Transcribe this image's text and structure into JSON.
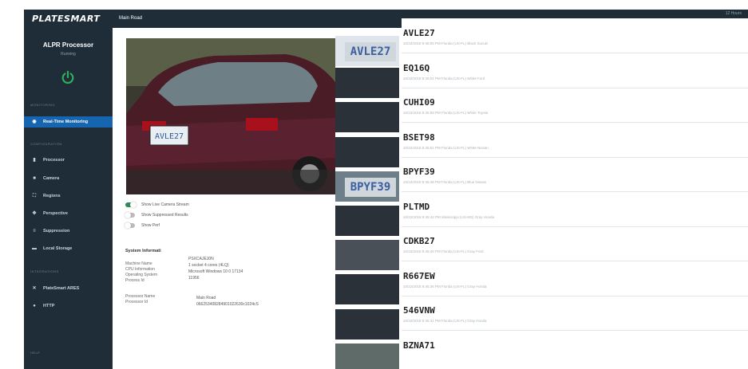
{
  "sidebar": {
    "logo": "PLATESMART",
    "title": "ALPR Processor",
    "status": "Running",
    "sections": [
      "MONITORING",
      "CONFIGURATION",
      "INTEGRATIONS",
      "HELP"
    ],
    "items": [
      {
        "label": "Real-Time Monitoring",
        "icon": "eye-icon",
        "active": true
      },
      {
        "label": "Processor",
        "icon": "processor-icon"
      },
      {
        "label": "Camera",
        "icon": "camera-icon"
      },
      {
        "label": "Regions",
        "icon": "regions-icon"
      },
      {
        "label": "Perspective",
        "icon": "perspective-icon"
      },
      {
        "label": "Suppression",
        "icon": "suppression-icon"
      },
      {
        "label": "Local Storage",
        "icon": "storage-icon"
      },
      {
        "label": "PlateSmart ARES",
        "icon": "ares-icon"
      },
      {
        "label": "HTTP",
        "icon": "http-icon"
      }
    ]
  },
  "header": {
    "title": "Main Road"
  },
  "toggles": [
    {
      "label": "Show Live Camera Stream",
      "on": true
    },
    {
      "label": "Show Suppressed Results",
      "on": false
    },
    {
      "label": "Show Perf",
      "on": false
    }
  ],
  "system": {
    "title": "System Informati",
    "labels": [
      "Machine Name",
      "CPU Information",
      "Operating System",
      "Process Id",
      "Processor Name",
      "Processor Id"
    ],
    "values": [
      "PSXCAJEJ0N",
      "1 socket 4 cores (4LQ)",
      "Microsoft Windows 10 0 17134",
      "11956",
      "Main Road",
      "066253408284901022630c1024cS"
    ]
  },
  "thumbs": [
    "AVLE27",
    "",
    "",
    "",
    "BPYF39",
    "",
    "",
    "",
    "",
    ""
  ],
  "plates": [
    {
      "number": "AVLE27",
      "meta": "10/22/2018 9:46:05 PM  Florida (US-FL)  Black Suzuki"
    },
    {
      "number": "EQ16Q",
      "meta": "10/22/2018 9:46:01 PM  Florida (US-FL)  White Ford"
    },
    {
      "number": "CUHI09",
      "meta": "10/22/2018 9:45:58 PM  Florida (US-FL)  White Toyota"
    },
    {
      "number": "BSET98",
      "meta": "10/22/2018 9:45:51 PM  Florida (US-FL)  White Nissan"
    },
    {
      "number": "BPYF39",
      "meta": "10/22/2018 9:45:48 PM  Florida (US-FL)  Blue Nissan"
    },
    {
      "number": "PLTMD",
      "meta": "10/22/2018 9:45:44 PM  Mississippi (US-MS)  Gray Honda"
    },
    {
      "number": "CDKB27",
      "meta": "10/22/2018 9:45:40 PM  Florida (US-FL)  Gray Ford"
    },
    {
      "number": "R667EW",
      "meta": "10/22/2018 9:45:36 PM  Florida (US-FL)  Gray Honda"
    },
    {
      "number": "546VNW",
      "meta": "10/22/2018 9:45:31 PM  Florida (US-FL)  Gray Honda"
    },
    {
      "number": "BZNA71",
      "meta": ""
    }
  ],
  "topbar_right": "12 Hours",
  "colors": {
    "sidebar": "#1f2d38",
    "active": "#1565b0",
    "toggle_on": "#2e8a57",
    "power": "#2fae5e"
  }
}
